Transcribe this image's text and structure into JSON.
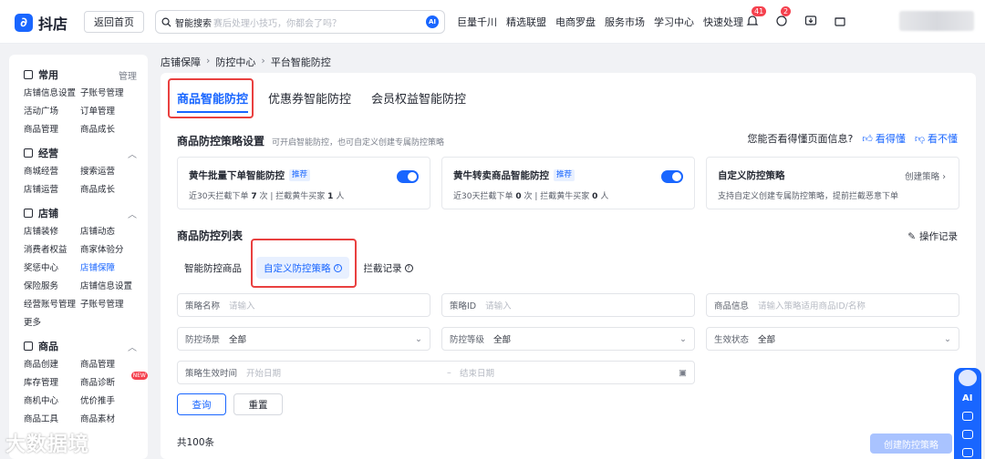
{
  "topbar": {
    "logo_text": "抖店",
    "home_button": "返回首页",
    "search_label": "智能搜索",
    "search_placeholder": "赛后处理小技巧，你都会了吗？",
    "ai_label": "AI",
    "nav": [
      "巨量千川",
      "精选联盟",
      "电商罗盘",
      "服务市场",
      "学习中心",
      "快速处理"
    ],
    "badges": {
      "bell": "41",
      "msg": "2"
    }
  },
  "sidebar": {
    "sections": [
      {
        "title": "常用",
        "right": "管理",
        "items": [
          "店铺信息设置",
          "子账号管理",
          "活动广场",
          "订单管理",
          "商品管理",
          "商品成长"
        ]
      },
      {
        "title": "经营",
        "items": [
          "商城经营",
          "搜索运营",
          "店铺运营",
          "商品成长"
        ]
      },
      {
        "title": "店铺",
        "items": [
          "店铺装修",
          "店铺动态",
          "消费者权益",
          "商家体验分",
          "奖惩中心",
          "店铺保障",
          "保险服务",
          "店铺信息设置",
          "经营账号管理",
          "子账号管理",
          "更多"
        ]
      },
      {
        "title": "商品",
        "items": [
          "商品创建",
          "商品管理",
          "库存管理",
          "商品诊断",
          "商机中心",
          "优价推手",
          "商品工具",
          "商品素材"
        ]
      }
    ]
  },
  "breadcrumb": [
    "店铺保障",
    "防控中心",
    "平台智能防控"
  ],
  "tabs": [
    "商品智能防控",
    "优惠券智能防控",
    "会员权益智能防控"
  ],
  "strategy": {
    "title": "商品防控策略设置",
    "hint": "可开启智能防控，也可自定义创建专属防控策略",
    "feedback_q": "您能否看得懂页面信息?",
    "feedback_yes": "看得懂",
    "feedback_no": "看不懂"
  },
  "cards": [
    {
      "title": "黄牛批量下单智能防控",
      "tag": "推荐",
      "d1": "近30天拦截下单",
      "v1": "7",
      "u1": "次",
      "sep": "|",
      "d2": "拦截黄牛买家",
      "v2": "1",
      "u2": "人"
    },
    {
      "title": "黄牛转卖商品智能防控",
      "tag": "推荐",
      "d1": "近30天拦截下单",
      "v1": "0",
      "u1": "次",
      "sep": "|",
      "d2": "拦截黄牛买家",
      "v2": "0",
      "u2": "人"
    },
    {
      "title": "自定义防控策略",
      "link": "创建策略",
      "desc": "支持自定义创建专属防控策略，提前拦截恶意下单"
    }
  ],
  "list": {
    "title": "商品防控列表",
    "oplog": "操作记录",
    "subtabs": [
      "智能防控商品",
      "自定义防控策略",
      "拦截记录"
    ]
  },
  "filters": {
    "name_label": "策略名称",
    "name_ph": "请输入",
    "id_label": "策略ID",
    "id_ph": "请输入",
    "goods_label": "商品信息",
    "goods_ph": "请输入策略适用商品ID/名称",
    "scene_label": "防控场景",
    "scene_val": "全部",
    "level_label": "防控等级",
    "level_val": "全部",
    "status_label": "生效状态",
    "status_val": "全部",
    "time_label": "策略生效时间",
    "start_ph": "开始日期",
    "end_ph": "结束日期"
  },
  "buttons": {
    "query": "查询",
    "reset": "重置",
    "create": "创建防控策略"
  },
  "total": "共100条",
  "float": {
    "ai": "AI"
  },
  "watermark": "大数据境"
}
